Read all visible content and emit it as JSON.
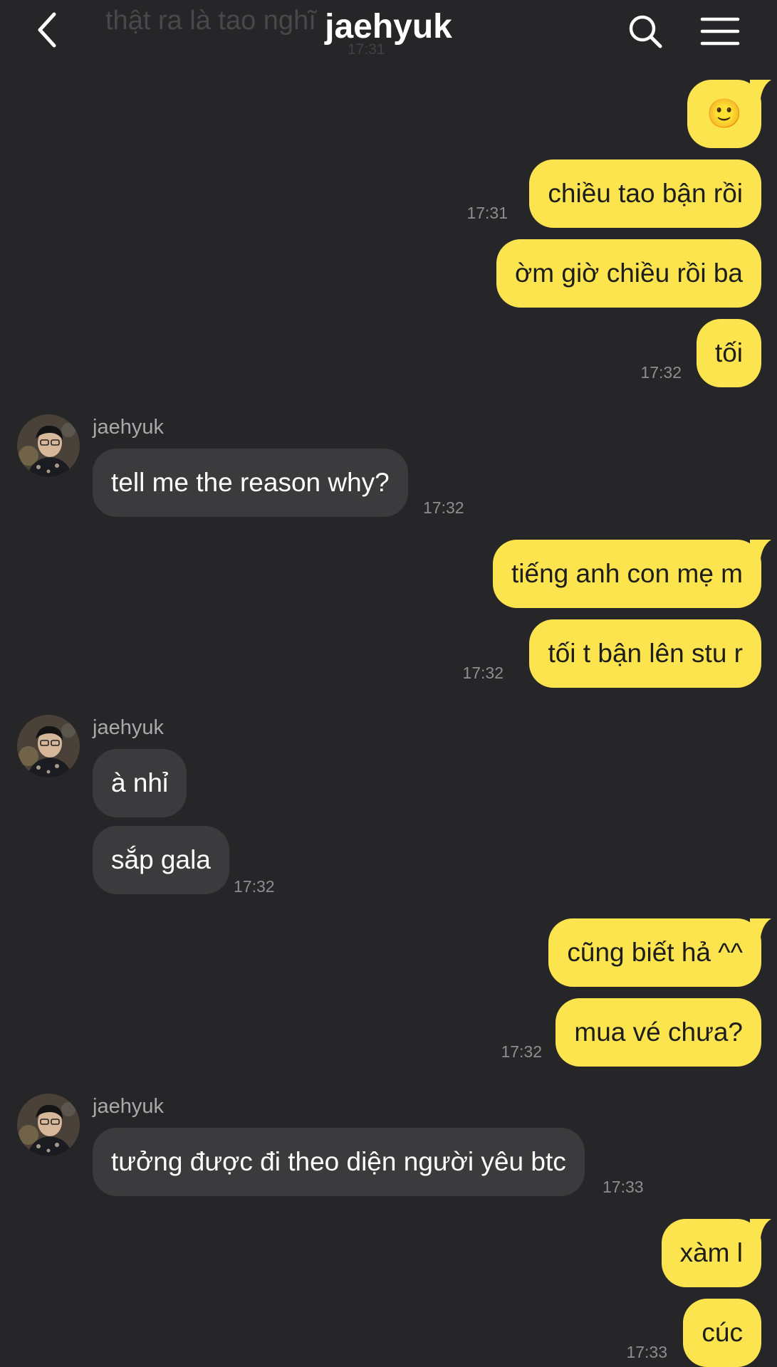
{
  "header": {
    "title": "jaehyuk",
    "ghost_preview": "thật ra là tao nghĩ",
    "ghost_time": "17:31",
    "back_icon": "chevron-left-icon",
    "search_icon": "search-icon",
    "menu_icon": "hamburger-menu-icon"
  },
  "colors": {
    "background": "#262628",
    "outgoing_bubble": "#fbe44d",
    "incoming_bubble": "#3b3b3d",
    "timestamp": "#8e8e90"
  },
  "messages": [
    {
      "dir": "out",
      "text": "🙂",
      "time": ""
    },
    {
      "dir": "out",
      "text": "chiều tao bận rồi",
      "time": "17:31"
    },
    {
      "dir": "out",
      "text": "ờm giờ chiều rồi ba",
      "time": ""
    },
    {
      "dir": "out",
      "text": "tối",
      "time": "17:32"
    },
    {
      "dir": "in",
      "sender": "jaehyuk",
      "text": "tell me the reason why?",
      "time": "17:32"
    },
    {
      "dir": "out",
      "text": "tiếng anh con mẹ m",
      "time": ""
    },
    {
      "dir": "out",
      "text": "tối t bận lên stu r",
      "time": "17:32"
    },
    {
      "dir": "in",
      "sender": "jaehyuk",
      "text": "à nhỉ",
      "time": ""
    },
    {
      "dir": "in",
      "text": "sắp gala",
      "time": "17:32"
    },
    {
      "dir": "out",
      "text": "cũng biết hả ^^",
      "time": ""
    },
    {
      "dir": "out",
      "text": "mua vé chưa?",
      "time": "17:32"
    },
    {
      "dir": "in",
      "sender": "jaehyuk",
      "text": "tưởng được đi theo diện người yêu btc",
      "time": "17:33"
    },
    {
      "dir": "out",
      "text": "xàm l",
      "time": ""
    },
    {
      "dir": "out",
      "text": "cúc",
      "time": "17:33"
    }
  ]
}
